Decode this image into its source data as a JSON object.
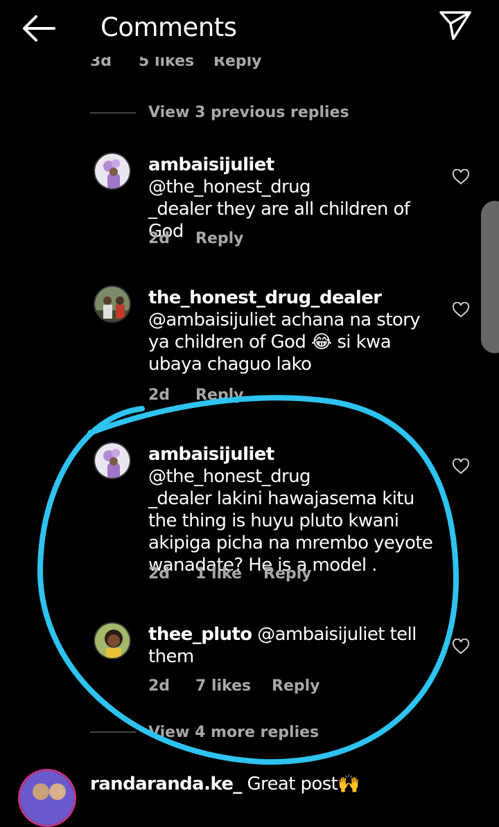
{
  "header": {
    "title": "Comments",
    "back_icon": "arrow-left-icon",
    "send_icon": "paper-plane-icon"
  },
  "previous_row": {
    "age": "3d",
    "likes": "5 likes",
    "reply": "Reply"
  },
  "view_previous": "View 3 previous replies",
  "comments": [
    {
      "username": "ambaisijuliet",
      "text": " @the_honest_drug\n_dealer they are all children of\nGod",
      "age": "2d",
      "likes": "",
      "reply": "Reply"
    },
    {
      "username": "the_honest_drug_dealer",
      "text": "\n@ambaisijuliet achana na story\nya children of God 😂 si kwa\nubaya chaguo lako",
      "age": "2d",
      "likes": "",
      "reply": "Reply"
    },
    {
      "username": "ambaisijuliet",
      "text": " @the_honest_drug\n_dealer  lakini hawajasema kitu\nthe thing is huyu pluto kwani\nakipiga picha na mrembo yeyote\nwanadate? He is a model .",
      "age": "2d",
      "likes": "1 like",
      "reply": "Reply"
    },
    {
      "username": "thee_pluto",
      "text": " @ambaisijuliet tell\nthem",
      "age": "2d",
      "likes": "7 likes",
      "reply": "Reply"
    }
  ],
  "view_more": "View 4 more replies",
  "bottom_comment": {
    "username": "randaranda.ke_",
    "text": " Great post🙌"
  },
  "colors": {
    "background": "#000000",
    "meta_text": "#a8a8a8",
    "annotation_circle": "#2ec3f0"
  }
}
